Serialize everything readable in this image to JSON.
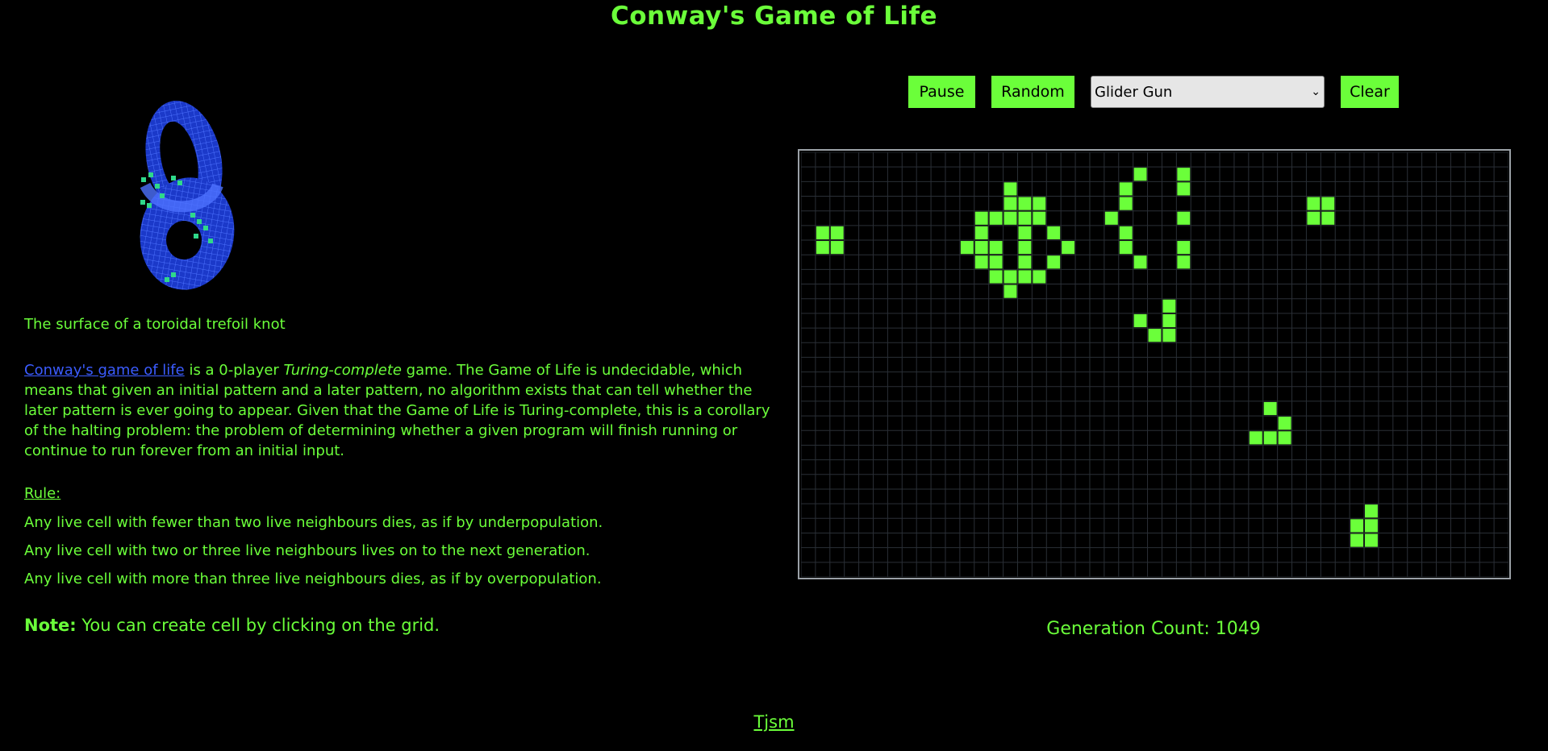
{
  "title": "Conway's Game of Life",
  "left": {
    "caption": "The surface of a toroidal trefoil knot",
    "link_text": "Conway's game of life",
    "desc_part1": " is a 0-player ",
    "desc_italic": "Turing-complete",
    "desc_part2": " game. The Game of Life is undecidable, which means that given an initial pattern and a later pattern, no algorithm exists that can tell whether the later pattern is ever going to appear. Given that the Game of Life is Turing-complete, this is a corollary of the halting problem: the problem of determining whether a given program will finish running or continue to run forever from an initial input.",
    "rule_heading": "Rule:",
    "rules": [
      "Any live cell with fewer than two live neighbours dies, as if by underpopulation.",
      "Any live cell with two or three live neighbours lives on to the next generation.",
      "Any live cell with more than three live neighbours dies, as if by overpopulation."
    ],
    "note_label": "Note:",
    "note_text": " You can create cell by clicking on the grid."
  },
  "controls": {
    "pause": "Pause",
    "random": "Random",
    "pattern_selected": "Glider Gun",
    "clear": "Clear"
  },
  "generation_label": "Generation Count: 1049",
  "footer_link": "Tjsm",
  "colors": {
    "accent": "#6bff3a",
    "link": "#3b5cff",
    "grid_line": "#2a2f36",
    "knot": "#1f3fd8"
  },
  "grid": {
    "cols": 49,
    "rows": 29,
    "live": [
      [
        23,
        1
      ],
      [
        26,
        1
      ],
      [
        14,
        2
      ],
      [
        22,
        2
      ],
      [
        26,
        2
      ],
      [
        14,
        3
      ],
      [
        15,
        3
      ],
      [
        16,
        3
      ],
      [
        22,
        3
      ],
      [
        35,
        3
      ],
      [
        36,
        3
      ],
      [
        12,
        4
      ],
      [
        13,
        4
      ],
      [
        14,
        4
      ],
      [
        15,
        4
      ],
      [
        16,
        4
      ],
      [
        21,
        4
      ],
      [
        26,
        4
      ],
      [
        35,
        4
      ],
      [
        36,
        4
      ],
      [
        1,
        5
      ],
      [
        2,
        5
      ],
      [
        12,
        5
      ],
      [
        15,
        5
      ],
      [
        17,
        5
      ],
      [
        22,
        5
      ],
      [
        1,
        6
      ],
      [
        2,
        6
      ],
      [
        11,
        6
      ],
      [
        12,
        6
      ],
      [
        13,
        6
      ],
      [
        15,
        6
      ],
      [
        18,
        6
      ],
      [
        22,
        6
      ],
      [
        26,
        6
      ],
      [
        12,
        7
      ],
      [
        13,
        7
      ],
      [
        15,
        7
      ],
      [
        17,
        7
      ],
      [
        23,
        7
      ],
      [
        26,
        7
      ],
      [
        13,
        8
      ],
      [
        14,
        8
      ],
      [
        15,
        8
      ],
      [
        16,
        8
      ],
      [
        14,
        9
      ],
      [
        25,
        10
      ],
      [
        23,
        11
      ],
      [
        25,
        11
      ],
      [
        24,
        12
      ],
      [
        25,
        12
      ],
      [
        32,
        17
      ],
      [
        33,
        18
      ],
      [
        31,
        19
      ],
      [
        32,
        19
      ],
      [
        33,
        19
      ],
      [
        39,
        24
      ],
      [
        38,
        25
      ],
      [
        39,
        25
      ],
      [
        38,
        26
      ],
      [
        39,
        26
      ]
    ]
  }
}
